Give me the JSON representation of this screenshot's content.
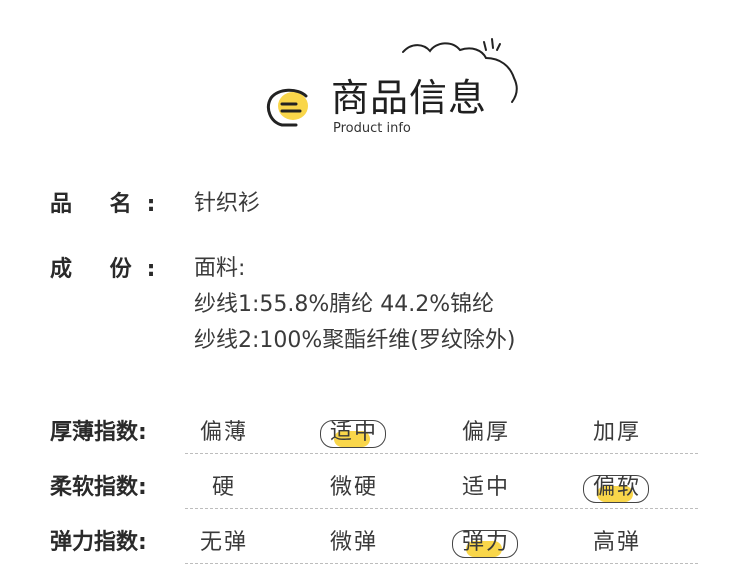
{
  "header": {
    "title": "商品信息",
    "subtitle": "Product info"
  },
  "product": {
    "name_label": "品  名:",
    "name_value": "针织衫",
    "composition_label": "成  份:",
    "composition_lines": [
      "面料:",
      "纱线1:55.8%腈纶 44.2%锦纶",
      "纱线2:100%聚酯纤维(罗纹除外)"
    ]
  },
  "ratings": [
    {
      "label": "厚薄指数:",
      "options": [
        "偏薄",
        "适中",
        "偏厚",
        "加厚"
      ],
      "selected": 1
    },
    {
      "label": "柔软指数:",
      "options": [
        "硬",
        "微硬",
        "适中",
        "偏软"
      ],
      "selected": 3
    },
    {
      "label": "弹力指数:",
      "options": [
        "无弹",
        "微弹",
        "弹力",
        "高弹"
      ],
      "selected": 2
    }
  ],
  "colors": {
    "accent": "#f9d64a",
    "text": "#333333",
    "divider": "#bdbdbd"
  },
  "icons": {
    "logo": "chat-bubble-icon",
    "decoration": "cloud-icon"
  }
}
